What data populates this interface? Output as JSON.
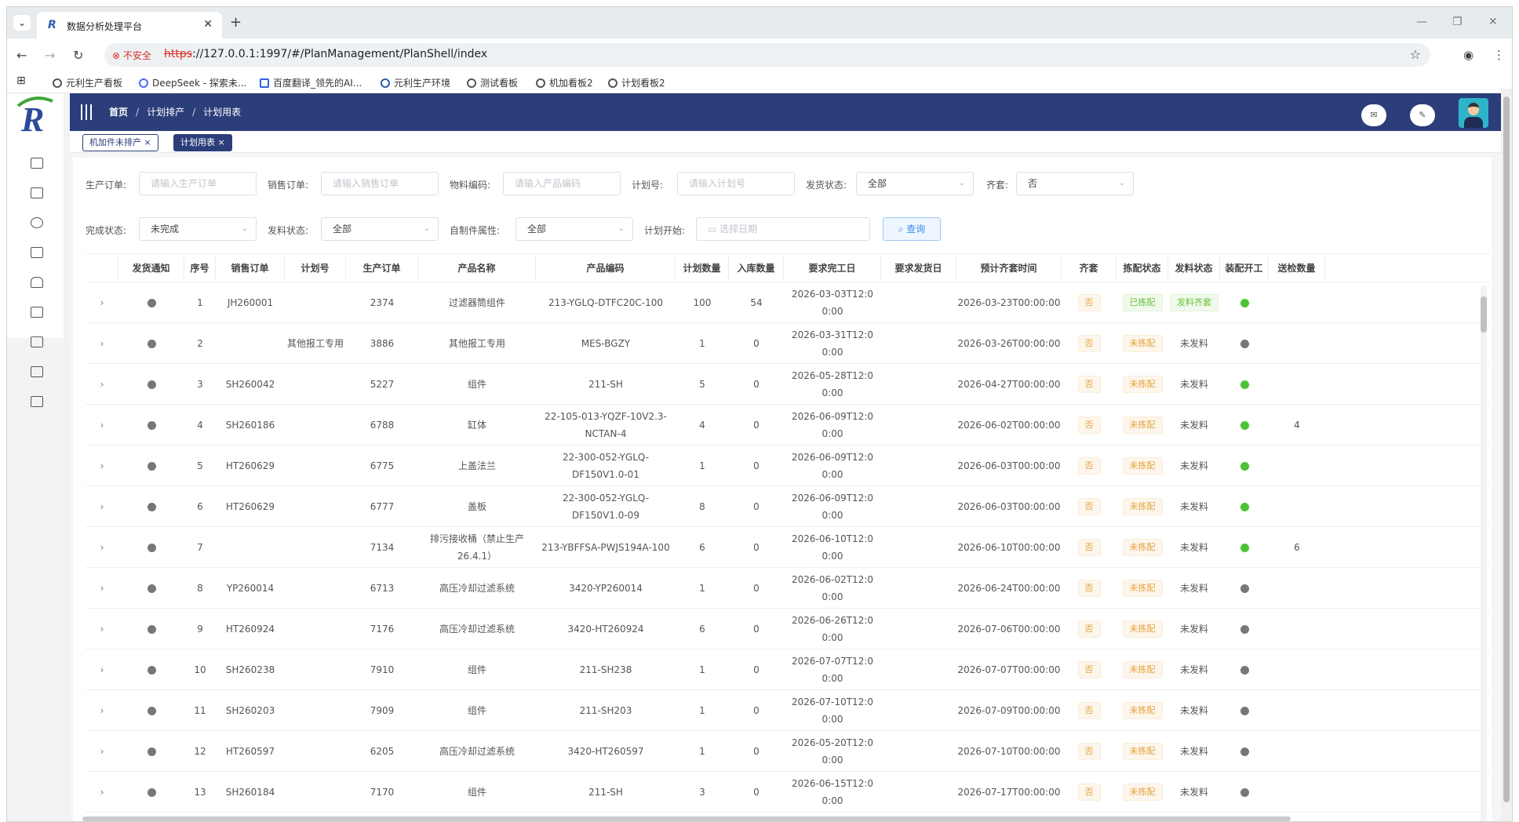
{
  "browser": {
    "tab_title": "数据分析处理平台",
    "tab_favicon": "R",
    "insecure_label": "不安全",
    "url_scheme": "https",
    "url_rest": "://127.0.0.1:1997/#/PlanManagement/PlanShell/index",
    "bookmarks": [
      "元利生产看板",
      "DeepSeek - 探索未...",
      "百度翻译_领先的AI...",
      "元利生产环境",
      "测试看板",
      "机加看板2",
      "计划看板2"
    ]
  },
  "header": {
    "breadcrumb": [
      "首页",
      "计划排产",
      "计划用表"
    ]
  },
  "tags": [
    {
      "label": "机加件未排产 ×",
      "active": false
    },
    {
      "label": "计划用表 ×",
      "active": true
    }
  ],
  "filters": {
    "production_order": {
      "label": "生产订单:",
      "placeholder": "请输入生产订单"
    },
    "sales_order": {
      "label": "销售订单:",
      "placeholder": "请输入销售订单"
    },
    "material_code": {
      "label": "物料编码:",
      "placeholder": "请输入产品编码"
    },
    "plan_no": {
      "label": "计划号:",
      "placeholder": "请输入计划号"
    },
    "ship_status": {
      "label": "发货状态:",
      "value": "全部"
    },
    "complete_set": {
      "label": "齐套:",
      "value": "否"
    },
    "finish_status": {
      "label": "完成状态:",
      "value": "未完成"
    },
    "issue_status": {
      "label": "发料状态:",
      "value": "全部"
    },
    "self_made": {
      "label": "自制件属性:",
      "value": "全部"
    },
    "plan_start": {
      "label": "计划开始:",
      "placeholder": "选择日期"
    },
    "query_button": "查询"
  },
  "table": {
    "columns": [
      "",
      "发货通知",
      "序号",
      "销售订单",
      "计划号",
      "生产订单",
      "产品名称",
      "产品编码",
      "计划数量",
      "入库数量",
      "要求完工日",
      "要求发货日",
      "预计齐套时间",
      "齐套",
      "拣配状态",
      "发料状态",
      "装配开工",
      "送检数量"
    ],
    "rows": [
      {
        "seq": "1",
        "sales": "JH260001",
        "plan": "",
        "prod": "2374",
        "name": "过滤器筒组件",
        "code": "213-YGLQ-DTFC20C-100",
        "qty": "100",
        "in": "54",
        "due1": "2026-03-03T12:0",
        "due2": "0:00",
        "ship": "",
        "eta": "2026-03-23T00:00:00",
        "set": "否",
        "pick": "已拣配",
        "pick_color": "green",
        "issue": "发料齐套",
        "issue_badge": true,
        "asm": "green",
        "inspect": ""
      },
      {
        "seq": "2",
        "sales": "",
        "plan": "其他报工专用",
        "prod": "3886",
        "name": "其他报工专用",
        "code": "MES-BGZY",
        "qty": "1",
        "in": "0",
        "due1": "2026-03-31T12:0",
        "due2": "0:00",
        "ship": "",
        "eta": "2026-03-26T00:00:00",
        "set": "否",
        "pick": "未拣配",
        "pick_color": "orange",
        "issue": "未发料",
        "issue_badge": false,
        "asm": "gray",
        "inspect": ""
      },
      {
        "seq": "3",
        "sales": "SH260042",
        "plan": "",
        "prod": "5227",
        "name": "组件",
        "code": "211-SH",
        "qty": "5",
        "in": "0",
        "due1": "2026-05-28T12:0",
        "due2": "0:00",
        "ship": "",
        "eta": "2026-04-27T00:00:00",
        "set": "否",
        "pick": "未拣配",
        "pick_color": "orange",
        "issue": "未发料",
        "issue_badge": false,
        "asm": "green",
        "inspect": ""
      },
      {
        "seq": "4",
        "sales": "SH260186",
        "plan": "",
        "prod": "6788",
        "name": "缸体",
        "code": "22-105-013-YQZF-10V2.3-NCTAN-4",
        "qty": "4",
        "in": "0",
        "due1": "2026-06-09T12:0",
        "due2": "0:00",
        "ship": "",
        "eta": "2026-06-02T00:00:00",
        "set": "否",
        "pick": "未拣配",
        "pick_color": "orange",
        "issue": "未发料",
        "issue_badge": false,
        "asm": "green",
        "inspect": "4"
      },
      {
        "seq": "5",
        "sales": "HT260629",
        "plan": "",
        "prod": "6775",
        "name": "上盖法兰",
        "code": "22-300-052-YGLQ-DF150V1.0-01",
        "qty": "1",
        "in": "0",
        "due1": "2026-06-09T12:0",
        "due2": "0:00",
        "ship": "",
        "eta": "2026-06-03T00:00:00",
        "set": "否",
        "pick": "未拣配",
        "pick_color": "orange",
        "issue": "未发料",
        "issue_badge": false,
        "asm": "green",
        "inspect": ""
      },
      {
        "seq": "6",
        "sales": "HT260629",
        "plan": "",
        "prod": "6777",
        "name": "盖板",
        "code": "22-300-052-YGLQ-DF150V1.0-09",
        "qty": "8",
        "in": "0",
        "due1": "2026-06-09T12:0",
        "due2": "0:00",
        "ship": "",
        "eta": "2026-06-03T00:00:00",
        "set": "否",
        "pick": "未拣配",
        "pick_color": "orange",
        "issue": "未发料",
        "issue_badge": false,
        "asm": "green",
        "inspect": ""
      },
      {
        "seq": "7",
        "sales": "",
        "plan": "",
        "prod": "7134",
        "name": "排污接收桶（禁止生产 26.4.1）",
        "code": "213-YBFFSA-PWJS194A-100",
        "qty": "6",
        "in": "0",
        "due1": "2026-06-10T12:0",
        "due2": "0:00",
        "ship": "",
        "eta": "2026-06-10T00:00:00",
        "set": "否",
        "pick": "未拣配",
        "pick_color": "orange",
        "issue": "未发料",
        "issue_badge": false,
        "asm": "green",
        "inspect": "6"
      },
      {
        "seq": "8",
        "sales": "YP260014",
        "plan": "",
        "prod": "6713",
        "name": "高压冷却过滤系统",
        "code": "3420-YP260014",
        "qty": "1",
        "in": "0",
        "due1": "2026-06-02T12:0",
        "due2": "0:00",
        "ship": "",
        "eta": "2026-06-24T00:00:00",
        "set": "否",
        "pick": "未拣配",
        "pick_color": "orange",
        "issue": "未发料",
        "issue_badge": false,
        "asm": "gray",
        "inspect": ""
      },
      {
        "seq": "9",
        "sales": "HT260924",
        "plan": "",
        "prod": "7176",
        "name": "高压冷却过滤系统",
        "code": "3420-HT260924",
        "qty": "6",
        "in": "0",
        "due1": "2026-06-26T12:0",
        "due2": "0:00",
        "ship": "",
        "eta": "2026-07-06T00:00:00",
        "set": "否",
        "pick": "未拣配",
        "pick_color": "orange",
        "issue": "未发料",
        "issue_badge": false,
        "asm": "gray",
        "inspect": ""
      },
      {
        "seq": "10",
        "sales": "SH260238",
        "plan": "",
        "prod": "7910",
        "name": "组件",
        "code": "211-SH238",
        "qty": "1",
        "in": "0",
        "due1": "2026-07-07T12:0",
        "due2": "0:00",
        "ship": "",
        "eta": "2026-07-07T00:00:00",
        "set": "否",
        "pick": "未拣配",
        "pick_color": "orange",
        "issue": "未发料",
        "issue_badge": false,
        "asm": "gray",
        "inspect": ""
      },
      {
        "seq": "11",
        "sales": "SH260203",
        "plan": "",
        "prod": "7909",
        "name": "组件",
        "code": "211-SH203",
        "qty": "1",
        "in": "0",
        "due1": "2026-07-10T12:0",
        "due2": "0:00",
        "ship": "",
        "eta": "2026-07-09T00:00:00",
        "set": "否",
        "pick": "未拣配",
        "pick_color": "orange",
        "issue": "未发料",
        "issue_badge": false,
        "asm": "gray",
        "inspect": ""
      },
      {
        "seq": "12",
        "sales": "HT260597",
        "plan": "",
        "prod": "6205",
        "name": "高压冷却过滤系统",
        "code": "3420-HT260597",
        "qty": "1",
        "in": "0",
        "due1": "2026-05-20T12:0",
        "due2": "0:00",
        "ship": "",
        "eta": "2026-07-10T00:00:00",
        "set": "否",
        "pick": "未拣配",
        "pick_color": "orange",
        "issue": "未发料",
        "issue_badge": false,
        "asm": "gray",
        "inspect": ""
      },
      {
        "seq": "13",
        "sales": "SH260184",
        "plan": "",
        "prod": "7170",
        "name": "组件",
        "code": "211-SH",
        "qty": "3",
        "in": "0",
        "due1": "2026-06-15T12:0",
        "due2": "0:00",
        "ship": "",
        "eta": "2026-07-17T00:00:00",
        "set": "否",
        "pick": "未拣配",
        "pick_color": "orange",
        "issue": "未发料",
        "issue_badge": false,
        "asm": "gray",
        "inspect": ""
      }
    ]
  },
  "colors": {
    "nav": "#2b3e7a",
    "green": "#4cc336",
    "gray": "#777777",
    "orange": "#e6a23c"
  }
}
